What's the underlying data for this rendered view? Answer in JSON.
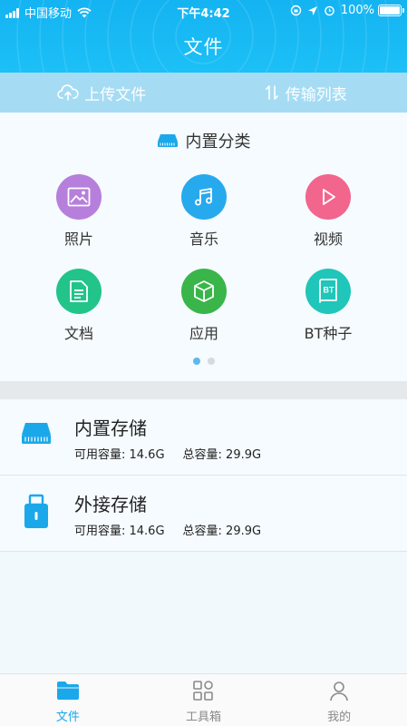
{
  "status_bar": {
    "carrier": "中国移动",
    "time": "下午4:42",
    "battery": "100%"
  },
  "header": {
    "title": "文件"
  },
  "actions": {
    "upload": "上传文件",
    "transfer": "传输列表"
  },
  "builtin_categories": {
    "title": "内置分类",
    "items": [
      {
        "label": "照片",
        "icon": "photo-icon",
        "color": "#b77fdc"
      },
      {
        "label": "音乐",
        "icon": "music-icon",
        "color": "#27a9ee"
      },
      {
        "label": "视频",
        "icon": "video-icon",
        "color": "#f2658d"
      },
      {
        "label": "文档",
        "icon": "document-icon",
        "color": "#22c489"
      },
      {
        "label": "应用",
        "icon": "app-box-icon",
        "color": "#39b54a"
      },
      {
        "label": "BT种子",
        "icon": "bt-torrent-icon",
        "color": "#1fc6b9"
      }
    ],
    "pager": {
      "pages": 2,
      "active": 0
    }
  },
  "storage": [
    {
      "name": "内置存储",
      "available": "可用容量: 14.6G",
      "total": "总容量: 29.9G",
      "icon": "internal-storage-icon"
    },
    {
      "name": "外接存储",
      "available": "可用容量: 14.6G",
      "total": "总容量: 29.9G",
      "icon": "external-storage-icon"
    }
  ],
  "tabbar": {
    "tabs": [
      {
        "label": "文件",
        "icon": "folder-icon",
        "active": true
      },
      {
        "label": "工具箱",
        "icon": "toolbox-icon",
        "active": false
      },
      {
        "label": "我的",
        "icon": "profile-icon",
        "active": false
      }
    ]
  },
  "colors": {
    "accent": "#1aa8ea",
    "header": "#19b9f4",
    "action_bar": "#a5dcf4",
    "inactive_tab": "#8a8a8a"
  }
}
